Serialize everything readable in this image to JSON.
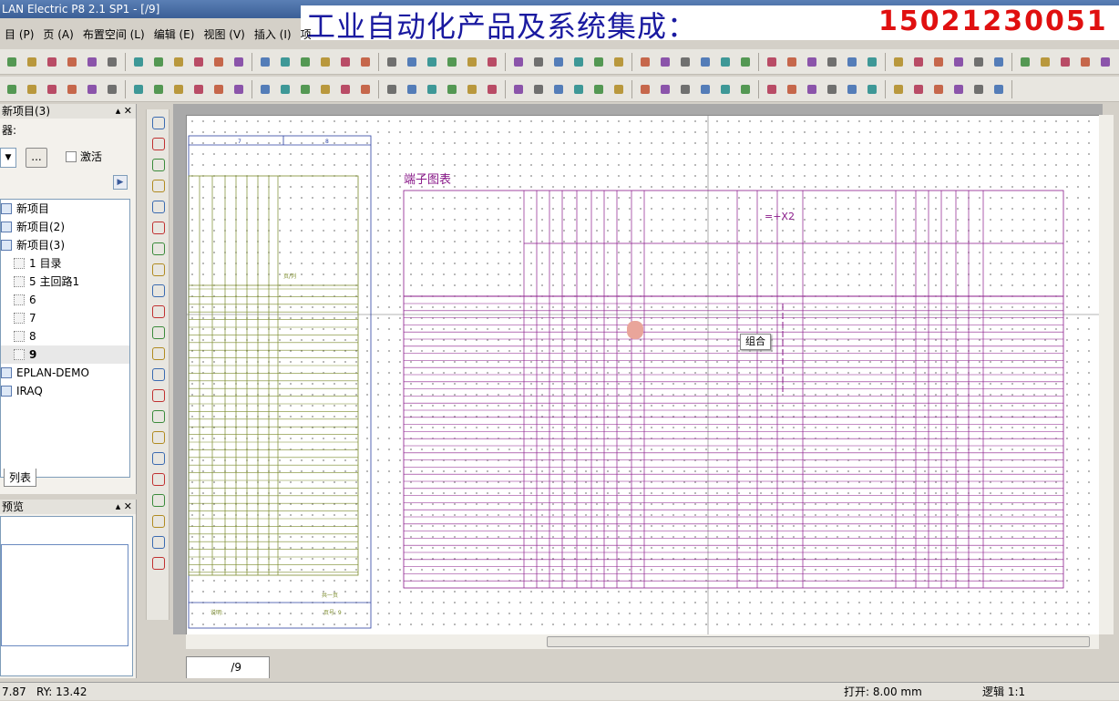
{
  "window": {
    "title": "LAN Electric P8 2.1 SP1 - [/9]"
  },
  "banner": {
    "text_cn": "工业自动化产品及系统集成：",
    "phone": "15021230051"
  },
  "menu": [
    "目 (P)",
    "页 (A)",
    "布置空间 (L)",
    "编辑 (E)",
    "视图 (V)",
    "插入 (I)",
    "项"
  ],
  "navigator": {
    "header": "新项目(3)",
    "filter_label": "器:",
    "activate_label": "激活",
    "button_dots": "...",
    "tree": [
      {
        "label": "新项目",
        "level": 0,
        "kind": "project"
      },
      {
        "label": "新项目(2)",
        "level": 0,
        "kind": "project"
      },
      {
        "label": "新项目(3)",
        "level": 0,
        "kind": "project"
      },
      {
        "label": "1 目录",
        "level": 1,
        "kind": "page"
      },
      {
        "label": "5 主回路1",
        "level": 1,
        "kind": "page"
      },
      {
        "label": "6",
        "level": 1,
        "kind": "page"
      },
      {
        "label": "7",
        "level": 1,
        "kind": "page"
      },
      {
        "label": "8",
        "level": 1,
        "kind": "page"
      },
      {
        "label": "9",
        "level": 1,
        "kind": "page",
        "selected": true
      },
      {
        "label": "EPLAN-DEMO",
        "level": 0,
        "kind": "project"
      },
      {
        "label": "IRAQ",
        "level": 0,
        "kind": "project"
      }
    ],
    "tab": "列表"
  },
  "preview": {
    "header": "预览"
  },
  "drawing": {
    "title": "端子图表",
    "strip_label": "=+X2",
    "left_sheet_numbers": [
      "7",
      "8"
    ],
    "footer_page": "页号: 9",
    "footer_total": "共一页",
    "footer_note": "说明:",
    "left_header_text": "页/列"
  },
  "tooltip": "组合",
  "tabs": [
    {
      "label": "/9"
    }
  ],
  "status": {
    "rx": "7.87",
    "ry": "RY: 13.42",
    "grid": "打开: 8.00 mm",
    "logic": "逻辑 1:1"
  }
}
